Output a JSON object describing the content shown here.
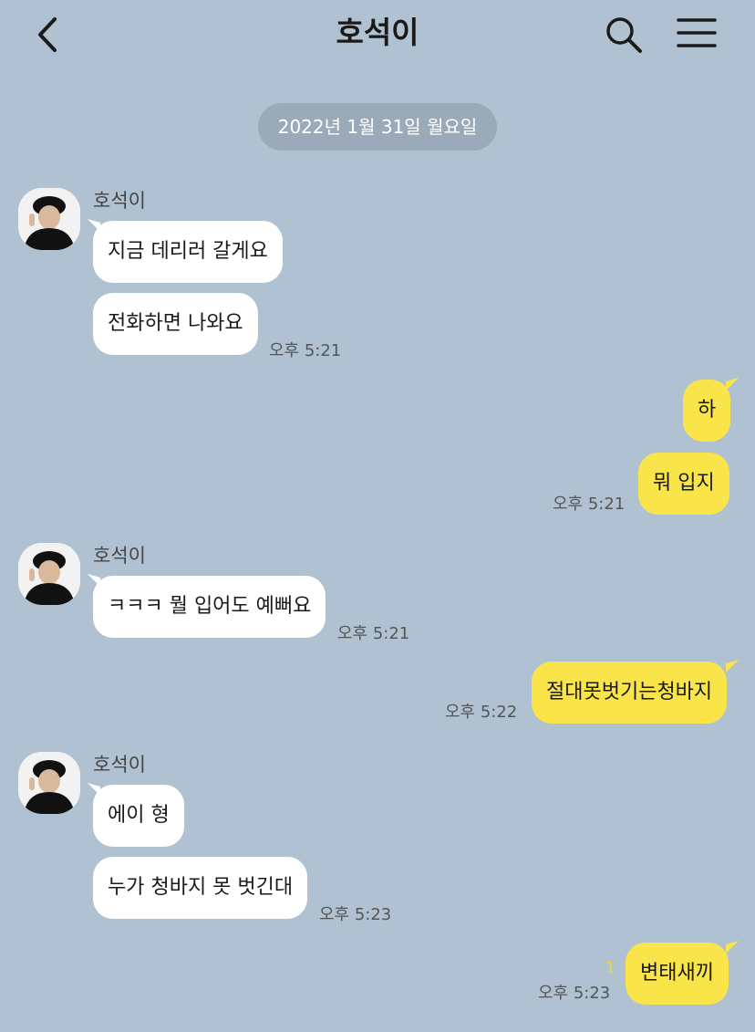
{
  "header": {
    "title": "호석이"
  },
  "date_divider": "2022년 1월 31일 월요일",
  "messages": {
    "g1": {
      "sender": "호석이",
      "m1": "지금 데리러 갈게요",
      "m2": "전화하면 나와요",
      "time": "오후 5:21"
    },
    "g2": {
      "m1": "하",
      "m2": "뭐 입지",
      "time": "오후 5:21"
    },
    "g3": {
      "sender": "호석이",
      "m1": "ㅋㅋㅋ 뭘 입어도 예뻐요",
      "time": "오후 5:21"
    },
    "g4": {
      "m1": "절대못벗기는청바지",
      "time": "오후 5:22"
    },
    "g5": {
      "sender": "호석이",
      "m1": "에이 형",
      "m2": "누가 청바지 못 벗긴대",
      "time": "오후 5:23"
    },
    "g6": {
      "m1": "변태새끼",
      "time": "오후 5:23",
      "unread": "1"
    }
  },
  "colors": {
    "background": "#b0c2d2",
    "outgoing": "#f9e54a",
    "incoming": "#ffffff"
  },
  "icons": {
    "back": "chevron-left-icon",
    "search": "search-icon",
    "menu": "hamburger-menu-icon"
  }
}
